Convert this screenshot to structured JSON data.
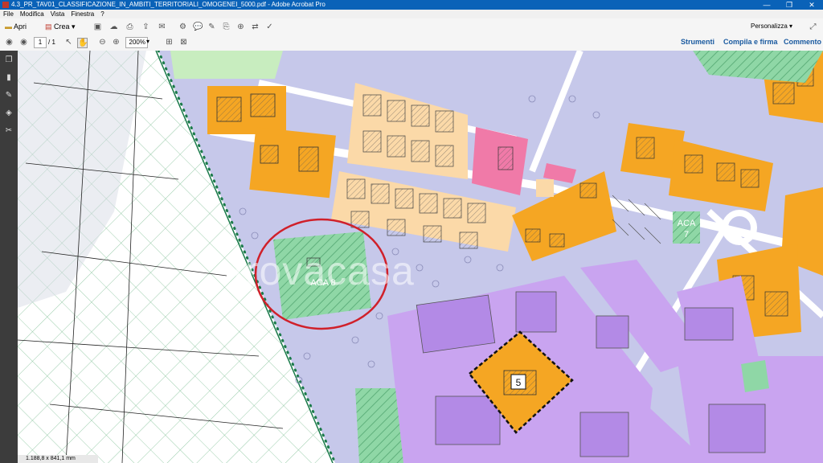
{
  "window": {
    "title": "4.3_PR_TAV01_CLASSIFICAZIONE_IN_AMBITI_TERRITORIALI_OMOGENEI_5000.pdf - Adobe Acrobat Pro",
    "minimize": "—",
    "maximize": "❐",
    "close": "✕"
  },
  "menu": [
    "File",
    "Modifica",
    "Vista",
    "Finestra",
    "?"
  ],
  "toolbar": {
    "open_label": "Apri",
    "create_label": "Crea",
    "customize_label": "Personalizza"
  },
  "nav": {
    "page_current": "1",
    "page_total": "/ 1",
    "zoom": "200%",
    "tools_label": "Strumenti",
    "sign_label": "Compila e firma",
    "comment_label": "Commento"
  },
  "map": {
    "labels": {
      "aca8": "ACA 8",
      "aca7_a": "ACA",
      "aca7_b": "7",
      "zone5": "5"
    },
    "watermark": "trovacasa",
    "colors": {
      "base": "#c6c8ea",
      "orange": "#f5a623",
      "light_orange": "#fbd9a8",
      "pink": "#f07aa8",
      "violet": "#c9a4f0",
      "green": "#8fd7a6",
      "red_circle": "#d0202a",
      "boundary": "#1a7a4a"
    }
  },
  "status": {
    "page_size": "1.188,8 x 841,1 mm"
  }
}
